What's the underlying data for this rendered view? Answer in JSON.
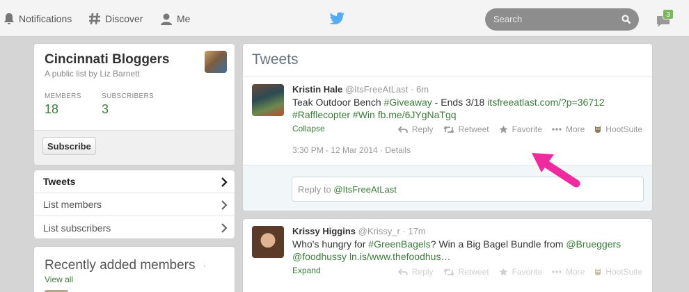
{
  "topbar": {
    "nav": [
      {
        "label": "Notifications",
        "icon": "bell-icon"
      },
      {
        "label": "Discover",
        "icon": "hashtag-icon"
      },
      {
        "label": "Me",
        "icon": "person-icon"
      }
    ],
    "search_placeholder": "Search",
    "messages_badge": "3",
    "brand_color": "#55acee"
  },
  "list": {
    "title": "Cincinnati Bloggers",
    "byline": "A public list by Liz Barnett",
    "members_label": "MEMBERS",
    "members_value": "18",
    "subscribers_label": "SUBSCRIBERS",
    "subscribers_value": "3",
    "subscribe_label": "Subscribe"
  },
  "list_nav": [
    {
      "label": "Tweets",
      "active": true
    },
    {
      "label": "List members",
      "active": false
    },
    {
      "label": "List subscribers",
      "active": false
    }
  ],
  "recent": {
    "title": "Recently added members",
    "dot": "·",
    "view_all": "View all"
  },
  "tweets": {
    "header": "Tweets",
    "items": [
      {
        "name": "Kristin Hale",
        "handle": "@ItsFreeAtLast",
        "sep": "·",
        "age": "6m",
        "line1_a": "Teak Outdoor Bench ",
        "line1_tag": "#Giveaway",
        "line1_b": " - Ends 3/18 ",
        "line1_link": "itsfreeatlast.com/?p=36712",
        "line2_tag1": "#Rafflecopter",
        "line2_tag2": "#Win",
        "line2_link": "fb.me/6JYgNaTgq",
        "toggle": "Collapse",
        "timestamp": "3:30 PM - 12 Mar 2014",
        "details": "Details",
        "reply_placeholder": "Reply to @ItsFreeAtLast"
      },
      {
        "name": "Krissy Higgins",
        "handle": "@Krissy_r",
        "sep": "·",
        "age": "17m",
        "line1_a": "Who's hungry for ",
        "line1_tag": "#GreenBagels",
        "line1_b": "? Win a Big Bagel Bundle from ",
        "line1_mention": "@Brueggers",
        "line2_mention": "@foodhussy",
        "line2_link": "ln.is/www.thefoodhus…",
        "toggle": "Expand"
      }
    ],
    "actions": {
      "reply": "Reply",
      "retweet": "Retweet",
      "favorite": "Favorite",
      "more": "More",
      "hootsuite": "HootSuite"
    }
  }
}
